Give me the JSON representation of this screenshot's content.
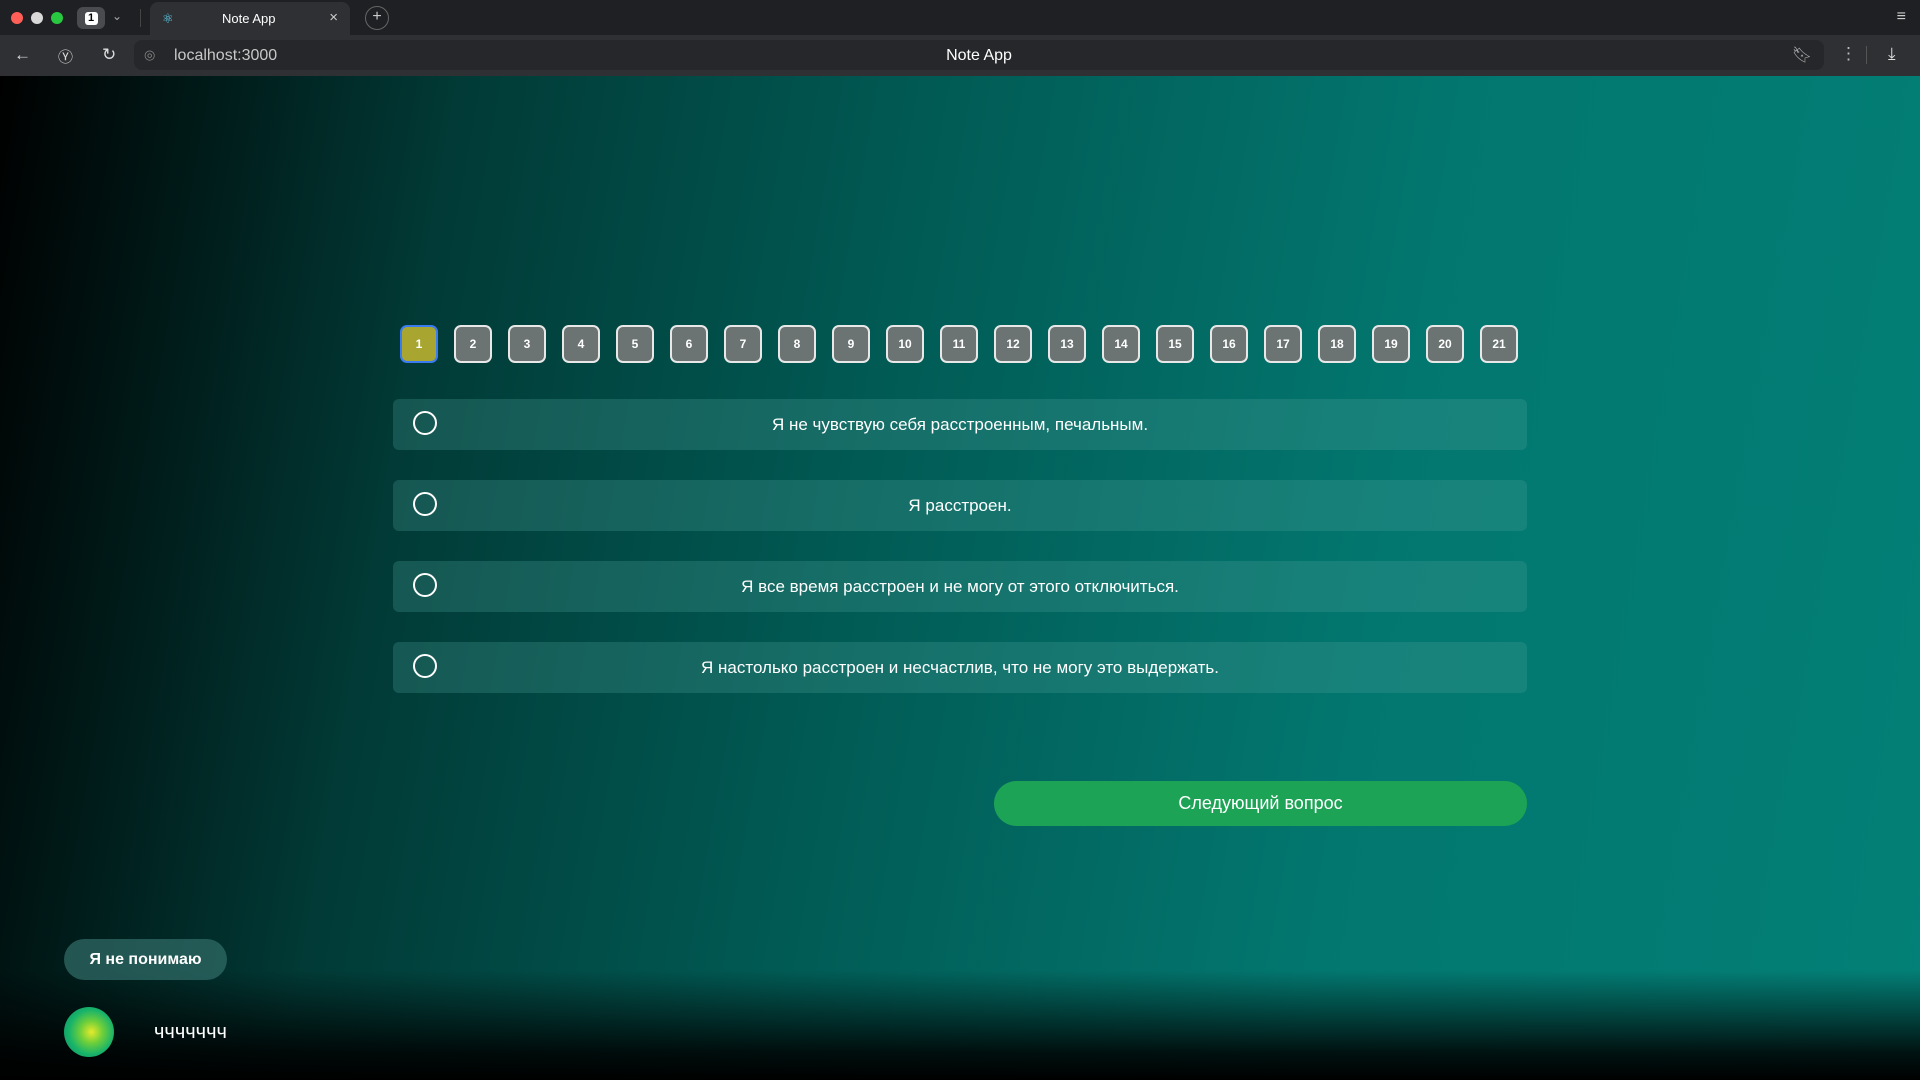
{
  "browser": {
    "tab_count": "1",
    "tab_title": "Note App",
    "url": "localhost:3000",
    "page_title": "Note App"
  },
  "questions": {
    "numbers": [
      "1",
      "2",
      "3",
      "4",
      "5",
      "6",
      "7",
      "8",
      "9",
      "10",
      "11",
      "12",
      "13",
      "14",
      "15",
      "16",
      "17",
      "18",
      "19",
      "20",
      "21"
    ],
    "active": "1"
  },
  "answers": [
    {
      "text": "Я не чувствую себя расстроенным, печальным."
    },
    {
      "text": "Я расстроен."
    },
    {
      "text": "Я все время расстроен и не могу от этого отключиться."
    },
    {
      "text": "Я настолько расстроен и несчастлив, что не могу это выдержать."
    }
  ],
  "next_button": "Следующий вопрос",
  "dunno_button": "Я не понимаю",
  "user_input": "ччччччч",
  "colors": {
    "active_question": "#a8a630",
    "next_button": "#1da355"
  }
}
